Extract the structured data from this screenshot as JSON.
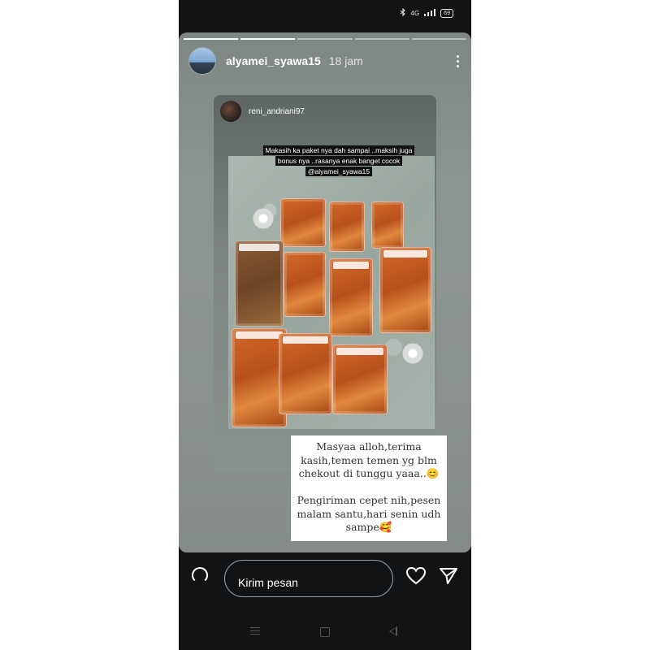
{
  "status_bar": {
    "network_label": "4G",
    "battery": "69"
  },
  "story": {
    "username": "alyamei_syawa15",
    "time": "18 jam",
    "progress": {
      "segments": 5,
      "active_index": 1,
      "active_fraction": 1.0
    }
  },
  "shared_post": {
    "username": "reni_andriani97",
    "caption": "Makasih ka paket nya dah sampai ..maksih juga bonus nya ..rasanya enak banget cocok @alyamei_syawa15"
  },
  "note": {
    "text": "Masyaa alloh,terima kasih,temen temen yg blm chekout di tunggu yaaa..😊\n\nPengiriman cepet nih,pesen malam santu,hari senin udh sampe🥰"
  },
  "reply_bar": {
    "placeholder": "Kirim pesan",
    "icons": [
      "camera-icon",
      "heart-icon",
      "send-icon"
    ]
  },
  "navigation": {
    "icons": [
      "menu-icon",
      "home-icon",
      "back-icon"
    ]
  },
  "colors": {
    "background": "#111315",
    "story_gradient": "#8a918e",
    "text_white": "#ffffff"
  }
}
